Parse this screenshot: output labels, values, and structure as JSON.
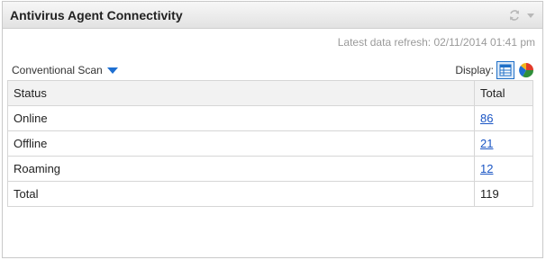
{
  "widget": {
    "title": "Antivirus Agent Connectivity",
    "refresh_icon": "refresh-icon",
    "menu_icon": "chevron-down-icon"
  },
  "refresh": {
    "text": "Latest data refresh: 02/11/2014 01:41 pm"
  },
  "controls": {
    "scan_type": "Conventional Scan",
    "display_label": "Display:",
    "table_view_icon": "table-view-icon",
    "pie_view_icon": "pie-chart-icon"
  },
  "table": {
    "headers": [
      "Status",
      "Total"
    ],
    "rows": [
      {
        "status": "Online",
        "total": "86"
      },
      {
        "status": "Offline",
        "total": "21"
      },
      {
        "status": "Roaming",
        "total": "12"
      },
      {
        "status": "Total",
        "total": "119"
      }
    ]
  },
  "colors": {
    "link": "#1a55c4",
    "accent": "#1e6fd1"
  }
}
